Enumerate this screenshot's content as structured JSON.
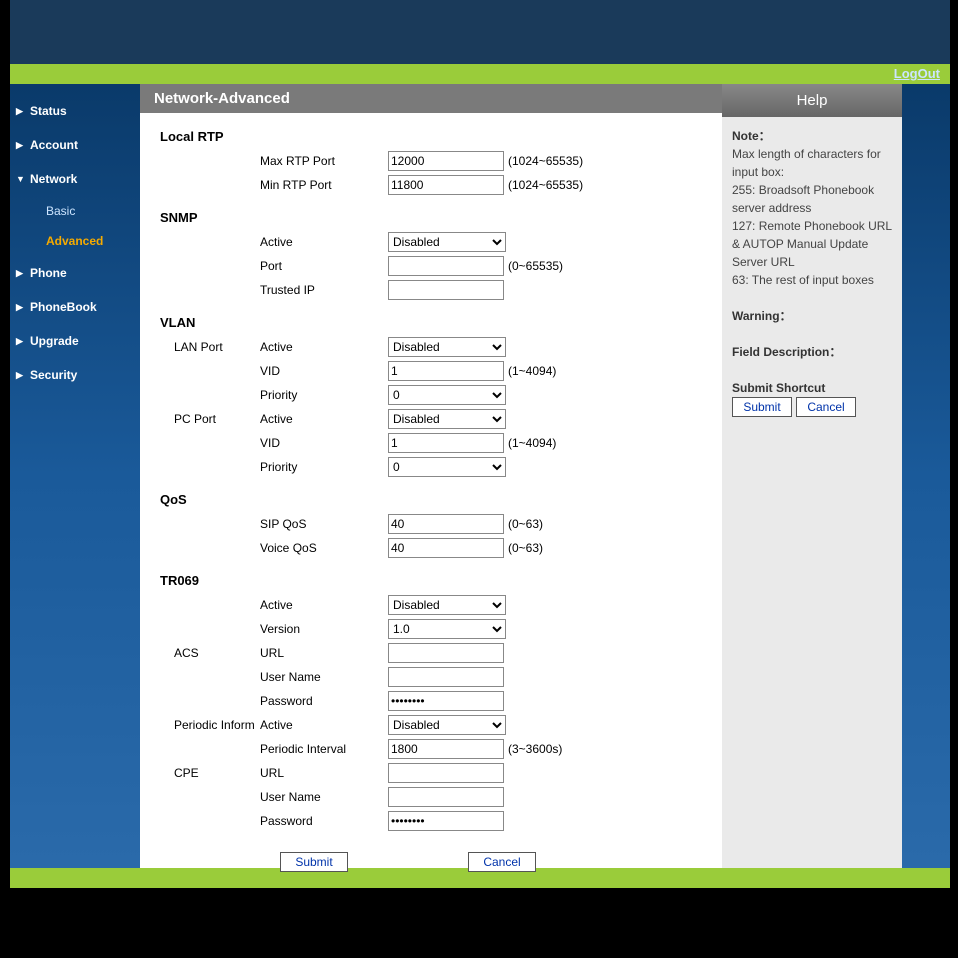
{
  "logout": "LogOut",
  "nav": {
    "status": "Status",
    "account": "Account",
    "network": "Network",
    "basic": "Basic",
    "advanced": "Advanced",
    "phone": "Phone",
    "phonebook": "PhoneBook",
    "upgrade": "Upgrade",
    "security": "Security"
  },
  "title": "Network-Advanced",
  "sections": {
    "local_rtp": "Local RTP",
    "snmp": "SNMP",
    "vlan": "VLAN",
    "qos": "QoS",
    "tr069": "TR069"
  },
  "labels": {
    "max_rtp_port": "Max RTP Port",
    "min_rtp_port": "Min RTP Port",
    "active": "Active",
    "port": "Port",
    "trusted_ip": "Trusted IP",
    "lan_port": "LAN Port",
    "pc_port": "PC Port",
    "vid": "VID",
    "priority": "Priority",
    "sip_qos": "SIP QoS",
    "voice_qos": "Voice QoS",
    "version": "Version",
    "acs": "ACS",
    "url": "URL",
    "username": "User Name",
    "password": "Password",
    "periodic_inform": "Periodic Inform",
    "periodic_interval": "Periodic Interval",
    "cpe": "CPE"
  },
  "values": {
    "max_rtp_port": "12000",
    "min_rtp_port": "11800",
    "snmp_active": "Disabled",
    "snmp_port": "",
    "snmp_trusted_ip": "",
    "lan_active": "Disabled",
    "lan_vid": "1",
    "lan_priority": "0",
    "pc_active": "Disabled",
    "pc_vid": "1",
    "pc_priority": "0",
    "sip_qos": "40",
    "voice_qos": "40",
    "tr069_active": "Disabled",
    "tr069_version": "1.0",
    "acs_url": "",
    "acs_user": "",
    "acs_pass": "••••••••",
    "periodic_active": "Disabled",
    "periodic_interval": "1800",
    "cpe_url": "",
    "cpe_user": "",
    "cpe_pass": "••••••••"
  },
  "hints": {
    "rtp_range": "(1024~65535)",
    "port_range": "(0~65535)",
    "vid_range": "(1~4094)",
    "qos_range": "(0~63)",
    "interval_range": "(3~3600s)"
  },
  "buttons": {
    "submit": "Submit",
    "cancel": "Cancel"
  },
  "help": {
    "title": "Help",
    "note_head": "Note：",
    "note1": "Max length of characters for input box:",
    "note2": "255: Broadsoft Phonebook server address",
    "note3": "127: Remote Phonebook URL & AUTOP Manual Update Server URL",
    "note4": "63: The rest of input boxes",
    "warning_head": "Warning：",
    "field_desc_head": "Field Description：",
    "shortcut_head": "Submit Shortcut"
  }
}
